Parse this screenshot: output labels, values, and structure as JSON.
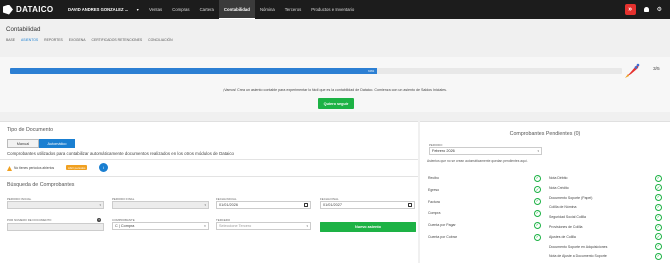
{
  "topbar": {
    "logo": "DATAICO",
    "company": "DAVID ANDRES GONZALEZ ...",
    "nav": [
      "Ventas",
      "Compras",
      "Cartera",
      "Contabilidad",
      "Nómina",
      "Terceros",
      "Productos e Inventario"
    ],
    "active_nav": "Contabilidad",
    "red_button": "»"
  },
  "header": {
    "title": "Contabilidad",
    "subnav": [
      "BASE",
      "ASIENTOS",
      "REPORTES",
      "EXOGENA",
      "CERTIFICADOS RETENCIONES",
      "CONCILIACIÓN"
    ],
    "active_subnav": "ASIENTOS"
  },
  "progress": {
    "percent_label": "60%",
    "fraction": 0.6,
    "steps": "3/5",
    "message": "¡Vamos! Crea un asiento contable para experimentar lo fácil que es la contabilidad de Dataico. Comienza con un asiento de Saldos Iniciales.",
    "button": "Quiero seguir"
  },
  "document_type": {
    "title": "Tipo de Documento",
    "manual": "Manual",
    "auto": "Automático",
    "description": "Comprobantes utilizados para contabilizar automáticamente documentos realizados en los otros módulos de Dataico"
  },
  "periods": {
    "warning": "No tienes periodos abiertos",
    "badge": "Abrir periodos",
    "info_icon": "i"
  },
  "search": {
    "title": "Búsqueda de Comprobantes",
    "periodo_inicial": {
      "label": "PERIODO INICIAL",
      "value": ""
    },
    "periodo_final": {
      "label": "PERIODO FINAL",
      "value": ""
    },
    "fecha_inicial": {
      "label": "FECHA INICIAL",
      "value": "01/01/2026"
    },
    "fecha_final": {
      "label": "FECHA FINAL",
      "value": "01/01/2027"
    },
    "numero_documento": {
      "label": "POR NUMERO DE DOCUMENTO",
      "value": ""
    },
    "comprobante": {
      "label": "COMPROBANTE",
      "value": "C | Compra"
    },
    "tercero": {
      "label": "TERCERO",
      "placeholder": "Seleccione Tercero"
    },
    "new_button": "Nuevo asiento"
  },
  "pending": {
    "title": "Comprobantes Pendientes (0)",
    "period_label": "PERIODO",
    "period_value": "Febrero 2026",
    "note": "Asientos que no se crean automáticamente quedan pendientes aquí.",
    "left_items": [
      "Recibo",
      "Egreso",
      "Factura",
      "Compra",
      "Cuenta por Pagar",
      "Cuenta por Cobrar"
    ],
    "right_items": [
      "Nota Débito",
      "Nota Crédito",
      "Documento Soporte (Papel)",
      "Colilla de Nómina",
      "Seguridad Social Colilla",
      "Provisiones de Colilla",
      "Ajustes de Colilla",
      "Documento Soporte en Adquisiciones",
      "Nota de Ajuste a Documento Soporte"
    ]
  },
  "colors": {
    "accent_blue": "#1a7fd1",
    "progress_blue": "#2c7fd3",
    "green": "#1db245",
    "red": "#e5312e",
    "topbar": "#1c1c1c"
  }
}
